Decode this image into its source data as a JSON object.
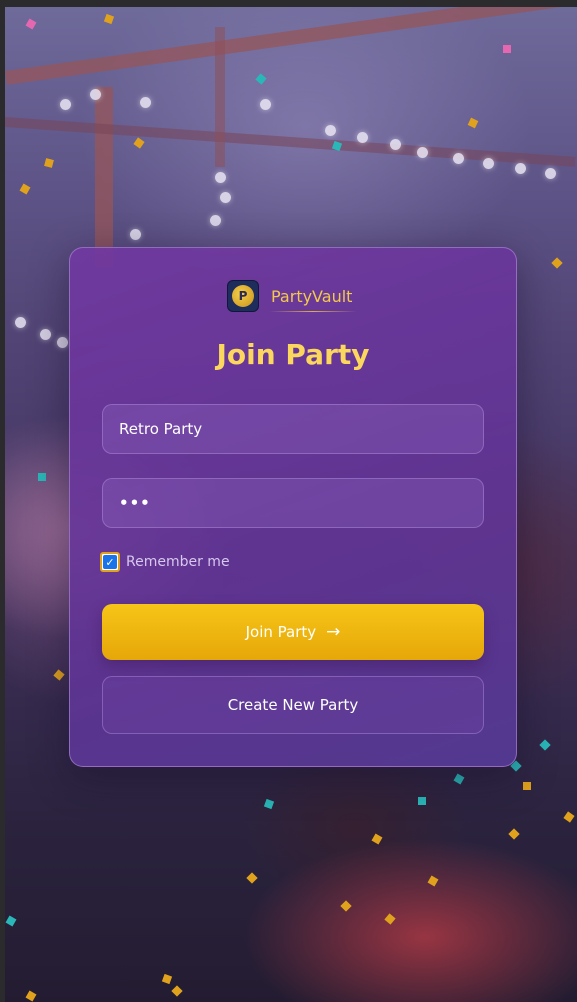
{
  "brand": {
    "name": "PartyVault",
    "logo_glyph": "P",
    "icon": "coin-logo-icon"
  },
  "form": {
    "title": "Join Party",
    "party_name_value": "Retro Party",
    "password_value": "•••",
    "remember_label": "Remember me",
    "remember_checked": true,
    "join_button_label": "Join Party",
    "join_arrow": "→",
    "create_button_label": "Create New Party",
    "check_glyph": "✓"
  },
  "colors": {
    "accent_gold": "#f6c518",
    "title_gold": "#fbd75e",
    "card_purple": "#7138a0",
    "checkbox_blue": "#1a73e8"
  }
}
